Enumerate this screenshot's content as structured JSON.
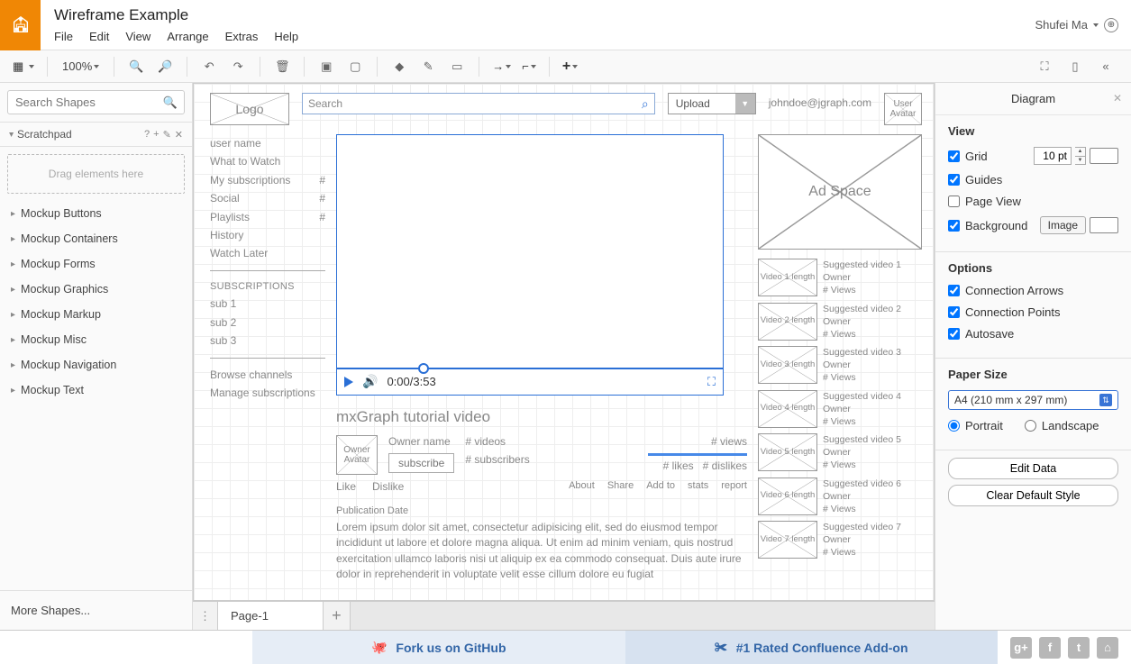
{
  "user": "Shufei Ma",
  "document_title": "Wireframe Example",
  "menubar": [
    "File",
    "Edit",
    "View",
    "Arrange",
    "Extras",
    "Help"
  ],
  "toolbar": {
    "zoom": "100%"
  },
  "sidebar_left": {
    "search_placeholder": "Search Shapes",
    "scratchpad_label": "Scratchpad",
    "scratchpad_drop": "Drag elements here",
    "categories": [
      "Mockup Buttons",
      "Mockup Containers",
      "Mockup Forms",
      "Mockup Graphics",
      "Mockup Markup",
      "Mockup Misc",
      "Mockup Navigation",
      "Mockup Text"
    ],
    "more_shapes": "More Shapes..."
  },
  "wireframe": {
    "logo": "Logo",
    "search_placeholder": "Search",
    "upload": "Upload",
    "email": "johndoe@jgraph.com",
    "avatar": "User Avatar",
    "nav": {
      "items": [
        "user name",
        "What to Watch",
        "My subscriptions",
        "Social",
        "Playlists",
        "History",
        "Watch Later"
      ],
      "hash_on": [
        2,
        3,
        4
      ],
      "section": "SUBSCRIPTIONS",
      "subs": [
        "sub 1",
        "sub 2",
        "sub 3"
      ],
      "browse": "Browse channels",
      "manage": "Manage subscriptions"
    },
    "video": {
      "current": "0:00",
      "total": "3:53",
      "title": "mxGraph tutorial video"
    },
    "owner_av": "Owner Avatar",
    "owner_line1": "Owner name",
    "subscribe": "subscribe",
    "videos": "# videos",
    "subscribers": "# subscribers",
    "views": "# views",
    "likes": "# likes",
    "dislikes": "# dislikes",
    "like": "Like",
    "dislike": "Dislike",
    "actions": [
      "About",
      "Share",
      "Add to",
      "stats",
      "report"
    ],
    "pub": "Publication Date",
    "lorem": "Lorem ipsum dolor sit amet, consectetur adipisicing elit, sed do eiusmod tempor incididunt ut labore et dolore magna aliqua. Ut enim ad minim veniam, quis nostrud exercitation ullamco laboris nisi ut aliquip ex ea commodo consequat. Duis aute irure dolor in reprehenderit in voluptate velit esse cillum dolore eu fugiat",
    "ad": "Ad Space",
    "suggested": [
      {
        "thumb": "Video 1 length",
        "title": "Suggested video 1",
        "owner": "Owner",
        "views": "# Views"
      },
      {
        "thumb": "Video 2 length",
        "title": "Suggested video 2",
        "owner": "Owner",
        "views": "# Views"
      },
      {
        "thumb": "Video 3 length",
        "title": "Suggested video 3",
        "owner": "Owner",
        "views": "# Views"
      },
      {
        "thumb": "Video 4 length",
        "title": "Suggested video 4",
        "owner": "Owner",
        "views": "# Views"
      },
      {
        "thumb": "Video 5 length",
        "title": "Suggested video 5",
        "owner": "Owner",
        "views": "# Views"
      },
      {
        "thumb": "Video 6 length",
        "title": "Suggested video 6",
        "owner": "Owner",
        "views": "# Views"
      },
      {
        "thumb": "Video 7 length",
        "title": "Suggested video 7",
        "owner": "Owner",
        "views": "# Views"
      }
    ]
  },
  "page_tab": "Page-1",
  "right_panel": {
    "title": "Diagram",
    "view_label": "View",
    "grid": "Grid",
    "grid_pt": "10 pt",
    "guides": "Guides",
    "page_view": "Page View",
    "background": "Background",
    "image_btn": "Image",
    "options_label": "Options",
    "conn_arrows": "Connection Arrows",
    "conn_points": "Connection Points",
    "autosave": "Autosave",
    "paper_label": "Paper Size",
    "paper_value": "A4 (210 mm x 297 mm)",
    "portrait": "Portrait",
    "landscape": "Landscape",
    "edit_data": "Edit Data",
    "clear_style": "Clear Default Style"
  },
  "footer": {
    "github": "Fork us on GitHub",
    "confluence": "#1 Rated Confluence Add-on"
  }
}
